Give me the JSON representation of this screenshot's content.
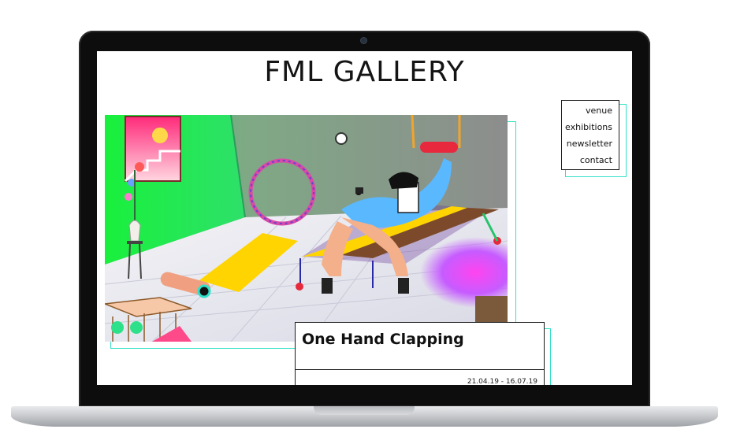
{
  "site": {
    "title": "FML GALLERY"
  },
  "nav": {
    "items": [
      {
        "label": "venue"
      },
      {
        "label": "exhibitions"
      },
      {
        "label": "newsletter"
      },
      {
        "label": "contact"
      }
    ]
  },
  "exhibition": {
    "title": "One Hand Clapping",
    "dates": "21.04.19 - 16.07.19"
  },
  "colors": {
    "accent_outline": "#35e0c8",
    "border": "#1b1b1b",
    "background": "#ffffff"
  }
}
